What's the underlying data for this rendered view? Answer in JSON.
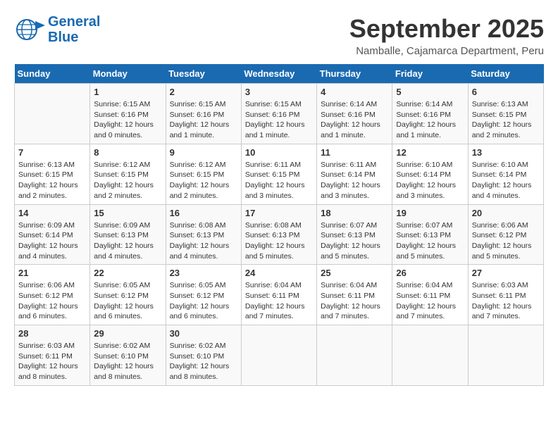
{
  "logo": {
    "line1": "General",
    "line2": "Blue"
  },
  "header": {
    "month": "September 2025",
    "location": "Namballe, Cajamarca Department, Peru"
  },
  "days_of_week": [
    "Sunday",
    "Monday",
    "Tuesday",
    "Wednesday",
    "Thursday",
    "Friday",
    "Saturday"
  ],
  "weeks": [
    [
      {
        "day": "",
        "info": ""
      },
      {
        "day": "1",
        "info": "Sunrise: 6:15 AM\nSunset: 6:16 PM\nDaylight: 12 hours\nand 0 minutes."
      },
      {
        "day": "2",
        "info": "Sunrise: 6:15 AM\nSunset: 6:16 PM\nDaylight: 12 hours\nand 1 minute."
      },
      {
        "day": "3",
        "info": "Sunrise: 6:15 AM\nSunset: 6:16 PM\nDaylight: 12 hours\nand 1 minute."
      },
      {
        "day": "4",
        "info": "Sunrise: 6:14 AM\nSunset: 6:16 PM\nDaylight: 12 hours\nand 1 minute."
      },
      {
        "day": "5",
        "info": "Sunrise: 6:14 AM\nSunset: 6:16 PM\nDaylight: 12 hours\nand 1 minute."
      },
      {
        "day": "6",
        "info": "Sunrise: 6:13 AM\nSunset: 6:15 PM\nDaylight: 12 hours\nand 2 minutes."
      }
    ],
    [
      {
        "day": "7",
        "info": "Sunrise: 6:13 AM\nSunset: 6:15 PM\nDaylight: 12 hours\nand 2 minutes."
      },
      {
        "day": "8",
        "info": "Sunrise: 6:12 AM\nSunset: 6:15 PM\nDaylight: 12 hours\nand 2 minutes."
      },
      {
        "day": "9",
        "info": "Sunrise: 6:12 AM\nSunset: 6:15 PM\nDaylight: 12 hours\nand 2 minutes."
      },
      {
        "day": "10",
        "info": "Sunrise: 6:11 AM\nSunset: 6:15 PM\nDaylight: 12 hours\nand 3 minutes."
      },
      {
        "day": "11",
        "info": "Sunrise: 6:11 AM\nSunset: 6:14 PM\nDaylight: 12 hours\nand 3 minutes."
      },
      {
        "day": "12",
        "info": "Sunrise: 6:10 AM\nSunset: 6:14 PM\nDaylight: 12 hours\nand 3 minutes."
      },
      {
        "day": "13",
        "info": "Sunrise: 6:10 AM\nSunset: 6:14 PM\nDaylight: 12 hours\nand 4 minutes."
      }
    ],
    [
      {
        "day": "14",
        "info": "Sunrise: 6:09 AM\nSunset: 6:14 PM\nDaylight: 12 hours\nand 4 minutes."
      },
      {
        "day": "15",
        "info": "Sunrise: 6:09 AM\nSunset: 6:13 PM\nDaylight: 12 hours\nand 4 minutes."
      },
      {
        "day": "16",
        "info": "Sunrise: 6:08 AM\nSunset: 6:13 PM\nDaylight: 12 hours\nand 4 minutes."
      },
      {
        "day": "17",
        "info": "Sunrise: 6:08 AM\nSunset: 6:13 PM\nDaylight: 12 hours\nand 5 minutes."
      },
      {
        "day": "18",
        "info": "Sunrise: 6:07 AM\nSunset: 6:13 PM\nDaylight: 12 hours\nand 5 minutes."
      },
      {
        "day": "19",
        "info": "Sunrise: 6:07 AM\nSunset: 6:13 PM\nDaylight: 12 hours\nand 5 minutes."
      },
      {
        "day": "20",
        "info": "Sunrise: 6:06 AM\nSunset: 6:12 PM\nDaylight: 12 hours\nand 5 minutes."
      }
    ],
    [
      {
        "day": "21",
        "info": "Sunrise: 6:06 AM\nSunset: 6:12 PM\nDaylight: 12 hours\nand 6 minutes."
      },
      {
        "day": "22",
        "info": "Sunrise: 6:05 AM\nSunset: 6:12 PM\nDaylight: 12 hours\nand 6 minutes."
      },
      {
        "day": "23",
        "info": "Sunrise: 6:05 AM\nSunset: 6:12 PM\nDaylight: 12 hours\nand 6 minutes."
      },
      {
        "day": "24",
        "info": "Sunrise: 6:04 AM\nSunset: 6:11 PM\nDaylight: 12 hours\nand 7 minutes."
      },
      {
        "day": "25",
        "info": "Sunrise: 6:04 AM\nSunset: 6:11 PM\nDaylight: 12 hours\nand 7 minutes."
      },
      {
        "day": "26",
        "info": "Sunrise: 6:04 AM\nSunset: 6:11 PM\nDaylight: 12 hours\nand 7 minutes."
      },
      {
        "day": "27",
        "info": "Sunrise: 6:03 AM\nSunset: 6:11 PM\nDaylight: 12 hours\nand 7 minutes."
      }
    ],
    [
      {
        "day": "28",
        "info": "Sunrise: 6:03 AM\nSunset: 6:11 PM\nDaylight: 12 hours\nand 8 minutes."
      },
      {
        "day": "29",
        "info": "Sunrise: 6:02 AM\nSunset: 6:10 PM\nDaylight: 12 hours\nand 8 minutes."
      },
      {
        "day": "30",
        "info": "Sunrise: 6:02 AM\nSunset: 6:10 PM\nDaylight: 12 hours\nand 8 minutes."
      },
      {
        "day": "",
        "info": ""
      },
      {
        "day": "",
        "info": ""
      },
      {
        "day": "",
        "info": ""
      },
      {
        "day": "",
        "info": ""
      }
    ]
  ]
}
